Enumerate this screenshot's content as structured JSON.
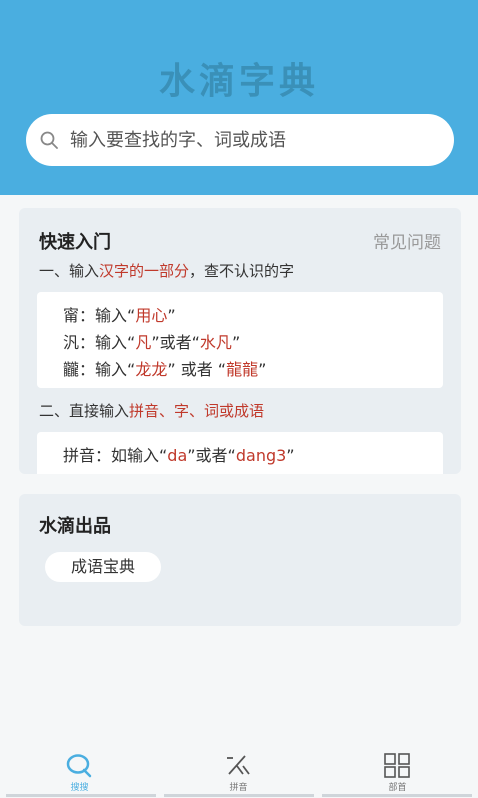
{
  "header": {
    "app_title": "水滴字典"
  },
  "search": {
    "placeholder": "输入要查找的字、词或成语"
  },
  "quick_start": {
    "title": "快速入门",
    "faq_link": "常见问题",
    "step1": {
      "prefix": "一、输入",
      "highlight": "汉字的一部分",
      "suffix": "，查不认识的字"
    },
    "examples1": [
      {
        "char": "甯",
        "text1": "：输入“",
        "h1": "用心",
        "text2": "”"
      },
      {
        "char": "汎",
        "text1": "：输入“",
        "h1": "凡",
        "text2": "”或者“",
        "h2": "水凡",
        "text3": "”"
      },
      {
        "char": "龖",
        "text1": "：输入“",
        "h1": "龙龙",
        "text2": "” 或者 “",
        "h2": "龍龍",
        "text3": "”"
      }
    ],
    "step2": {
      "prefix": "二、直接输入",
      "highlight": "拼音、字、词或成语"
    },
    "example2": {
      "label": "拼音：如输入“",
      "h1": "da",
      "mid": "”或者“",
      "h2": "dang3",
      "end": "”"
    }
  },
  "products": {
    "title": "水滴出品",
    "chip": "成语宝典"
  },
  "tabs": [
    {
      "label": "搜搜",
      "active": true,
      "icon": "search-tab-icon"
    },
    {
      "label": "拼音",
      "active": false,
      "icon": "pinyin-tab-icon"
    },
    {
      "label": "部首",
      "active": false,
      "icon": "radical-grid-icon"
    }
  ],
  "colors": {
    "header_bg": "#4aaee0",
    "highlight": "#c0392b",
    "active_tab": "#4aaee0"
  }
}
